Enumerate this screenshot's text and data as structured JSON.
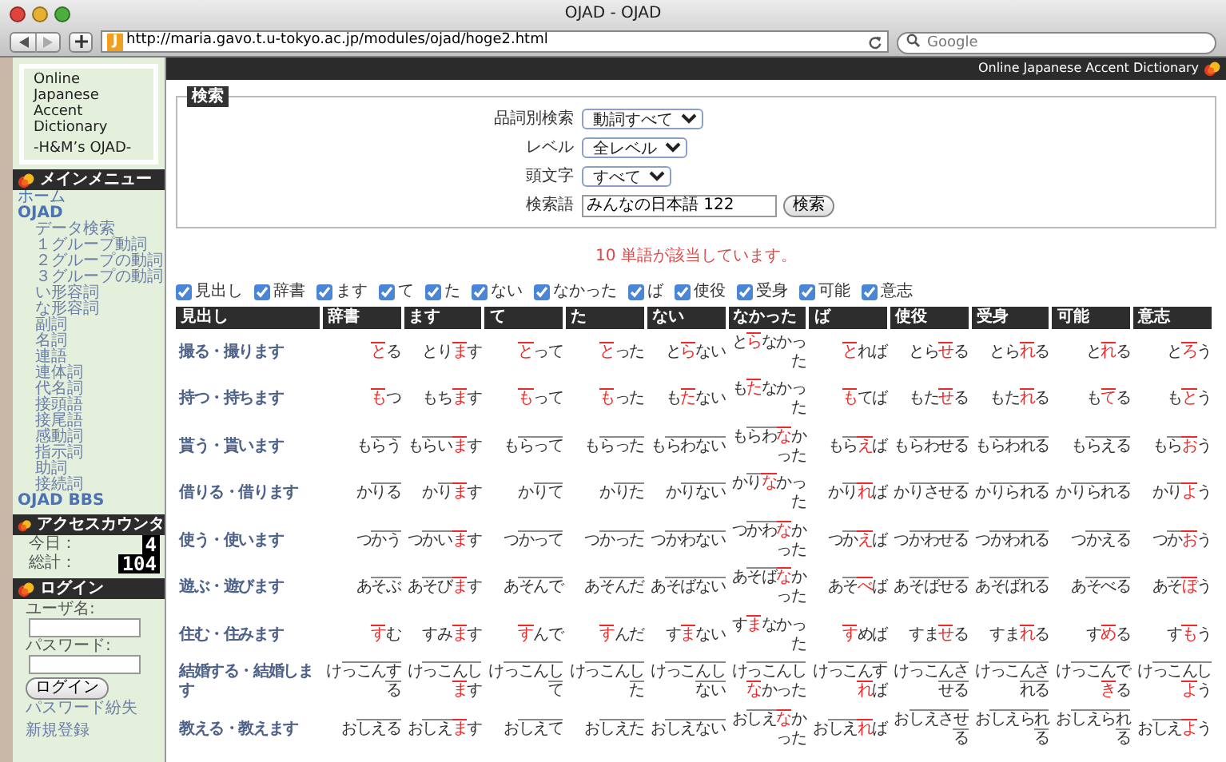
{
  "window": {
    "title": "OJAD - OJAD",
    "favicon": "J",
    "url": "http://maria.gavo.t.u-tokyo.ac.jp/modules/ojad/hoge2.html",
    "search_placeholder": "Google"
  },
  "sidebar": {
    "logo_lines": [
      "Online",
      "Japanese",
      "Accent",
      "Dictionary"
    ],
    "logo_tagline": "-H&M’s OJAD-",
    "menu_title": "メインメニュー",
    "menu": [
      {
        "label": "ホーム",
        "kind": "link"
      },
      {
        "label": "OJAD",
        "kind": "section",
        "children": [
          {
            "label": "データ検索"
          },
          {
            "label": "１グループ動詞"
          },
          {
            "label": "２グループの動詞"
          },
          {
            "label": "３グループの動詞"
          },
          {
            "label": "い形容詞"
          },
          {
            "label": "な形容詞"
          },
          {
            "label": "副詞"
          },
          {
            "label": "名詞"
          },
          {
            "label": "連語"
          },
          {
            "label": "連体詞"
          },
          {
            "label": "代名詞"
          },
          {
            "label": "接頭語"
          },
          {
            "label": "接尾語"
          },
          {
            "label": "感動詞"
          },
          {
            "label": "指示詞"
          },
          {
            "label": "助詞"
          },
          {
            "label": "接続詞"
          }
        ]
      },
      {
        "label": "OJAD BBS",
        "kind": "section"
      }
    ],
    "counter_title": "アクセスカウンタ",
    "counter": [
      {
        "label": "今日：",
        "value": "4"
      },
      {
        "label": "総計：",
        "value": "104"
      }
    ],
    "login_title": "ログイン",
    "login": {
      "username_label": "ユーザ名:",
      "password_label": "パスワード:",
      "button": "ログイン",
      "links": [
        "パスワード紛失",
        "新規登録"
      ]
    }
  },
  "header": "Online Japanese Accent Dictionary",
  "search": {
    "legend": "検索",
    "fields": [
      {
        "label": "品詞別検索",
        "kind": "select",
        "value": "動詞すべて"
      },
      {
        "label": "レベル",
        "kind": "select",
        "value": "全レベル"
      },
      {
        "label": "頭文字",
        "kind": "select",
        "value": "すべて"
      },
      {
        "label": "検索語",
        "kind": "text",
        "value": "みんなの日本語 122"
      }
    ],
    "button": "検索"
  },
  "result": "10 単語が該当しています。",
  "column_toggles": [
    {
      "label": "見出し",
      "checked": true
    },
    {
      "label": "辞書",
      "checked": true
    },
    {
      "label": "ます",
      "checked": true
    },
    {
      "label": "て",
      "checked": true
    },
    {
      "label": "た",
      "checked": true
    },
    {
      "label": "ない",
      "checked": true
    },
    {
      "label": "なかった",
      "checked": true
    },
    {
      "label": "ば",
      "checked": true
    },
    {
      "label": "使役",
      "checked": true
    },
    {
      "label": "受身",
      "checked": true
    },
    {
      "label": "可能",
      "checked": true
    },
    {
      "label": "意志",
      "checked": true
    }
  ],
  "table": {
    "columns": [
      "見出し",
      "辞書",
      "ます",
      "て",
      "た",
      "ない",
      "なかった",
      "ば",
      "使役",
      "受身",
      "可能",
      "意志"
    ],
    "rows": [
      {
        "headword": "撮る・撮ります",
        "forms": [
          [
            {
              "nucleus": "と"
            },
            {
              "low": "る"
            }
          ],
          [
            {
              "low": "とり"
            },
            {
              "nucleus": "ま"
            },
            {
              "low": "す"
            }
          ],
          [
            {
              "nucleus": "と"
            },
            {
              "low": "って"
            }
          ],
          [
            {
              "nucleus": "と"
            },
            {
              "low": "った"
            }
          ],
          [
            {
              "low": "と"
            },
            {
              "nucleus": "ら"
            },
            {
              "low": "ない"
            }
          ],
          [
            {
              "low": "と"
            },
            {
              "nucleus": "ら"
            },
            {
              "low": "なかった"
            }
          ],
          [
            {
              "nucleus": "と"
            },
            {
              "low": "れば"
            }
          ],
          [
            {
              "low": "とら"
            },
            {
              "nucleus": "せ"
            },
            {
              "low": "る"
            }
          ],
          [
            {
              "low": "とら"
            },
            {
              "nucleus": "れ"
            },
            {
              "low": "る"
            }
          ],
          [
            {
              "low": "と"
            },
            {
              "nucleus": "れ"
            },
            {
              "low": "る"
            }
          ],
          [
            {
              "low": "と"
            },
            {
              "nucleus": "ろ"
            },
            {
              "low": "う"
            }
          ]
        ]
      },
      {
        "headword": "持つ・持ちます",
        "forms": [
          [
            {
              "nucleus": "も"
            },
            {
              "low": "つ"
            }
          ],
          [
            {
              "low": "もち"
            },
            {
              "nucleus": "ま"
            },
            {
              "low": "す"
            }
          ],
          [
            {
              "nucleus": "も"
            },
            {
              "low": "って"
            }
          ],
          [
            {
              "nucleus": "も"
            },
            {
              "low": "った"
            }
          ],
          [
            {
              "low": "も"
            },
            {
              "nucleus": "た"
            },
            {
              "low": "ない"
            }
          ],
          [
            {
              "low": "も"
            },
            {
              "nucleus": "た"
            },
            {
              "low": "なかった"
            }
          ],
          [
            {
              "nucleus": "も"
            },
            {
              "low": "てば"
            }
          ],
          [
            {
              "low": "もた"
            },
            {
              "nucleus": "せ"
            },
            {
              "low": "る"
            }
          ],
          [
            {
              "low": "もた"
            },
            {
              "nucleus": "れ"
            },
            {
              "low": "る"
            }
          ],
          [
            {
              "low": "も"
            },
            {
              "nucleus": "て"
            },
            {
              "low": "る"
            }
          ],
          [
            {
              "low": "も"
            },
            {
              "nucleus": "と"
            },
            {
              "low": "う"
            }
          ]
        ]
      },
      {
        "headword": "貰う・貰います",
        "forms": [
          [
            {
              "low": "も"
            },
            {
              "high": "らう"
            }
          ],
          [
            {
              "low": "も"
            },
            {
              "high": "らい"
            },
            {
              "nucleus": "ま"
            },
            {
              "low": "す"
            }
          ],
          [
            {
              "low": "も"
            },
            {
              "high": "らって"
            }
          ],
          [
            {
              "low": "も"
            },
            {
              "high": "らった"
            }
          ],
          [
            {
              "low": "も"
            },
            {
              "high": "らわない"
            }
          ],
          [
            {
              "low": "も"
            },
            {
              "high": "らわ"
            },
            {
              "nucleus": "な"
            },
            {
              "low": "かった"
            }
          ],
          [
            {
              "low": "も"
            },
            {
              "high": "ら"
            },
            {
              "nucleus": "え"
            },
            {
              "low": "ば"
            }
          ],
          [
            {
              "low": "も"
            },
            {
              "high": "らわせる"
            }
          ],
          [
            {
              "low": "も"
            },
            {
              "high": "らわれる"
            }
          ],
          [
            {
              "low": "も"
            },
            {
              "high": "らえる"
            }
          ],
          [
            {
              "low": "も"
            },
            {
              "high": "ら"
            },
            {
              "nucleus": "お"
            },
            {
              "low": "う"
            }
          ]
        ]
      },
      {
        "headword": "借りる・借ります",
        "forms": [
          [
            {
              "low": "か"
            },
            {
              "high": "りる"
            }
          ],
          [
            {
              "low": "か"
            },
            {
              "high": "り"
            },
            {
              "nucleus": "ま"
            },
            {
              "low": "す"
            }
          ],
          [
            {
              "low": "か"
            },
            {
              "high": "りて"
            }
          ],
          [
            {
              "low": "か"
            },
            {
              "high": "りた"
            }
          ],
          [
            {
              "low": "か"
            },
            {
              "high": "りない"
            }
          ],
          [
            {
              "low": "か"
            },
            {
              "high": "り"
            },
            {
              "nucleus": "な"
            },
            {
              "low": "かった"
            }
          ],
          [
            {
              "low": "か"
            },
            {
              "high": "り"
            },
            {
              "nucleus": "れ"
            },
            {
              "low": "ば"
            }
          ],
          [
            {
              "low": "か"
            },
            {
              "high": "りさせる"
            }
          ],
          [
            {
              "low": "か"
            },
            {
              "high": "りられる"
            }
          ],
          [
            {
              "low": "か"
            },
            {
              "high": "りられる"
            }
          ],
          [
            {
              "low": "か"
            },
            {
              "high": "り"
            },
            {
              "nucleus": "よ"
            },
            {
              "low": "う"
            }
          ]
        ]
      },
      {
        "headword": "使う・使います",
        "forms": [
          [
            {
              "low": "つ"
            },
            {
              "high": "かう"
            }
          ],
          [
            {
              "low": "つ"
            },
            {
              "high": "かい"
            },
            {
              "nucleus": "ま"
            },
            {
              "low": "す"
            }
          ],
          [
            {
              "low": "つ"
            },
            {
              "high": "かって"
            }
          ],
          [
            {
              "low": "つ"
            },
            {
              "high": "かった"
            }
          ],
          [
            {
              "low": "つ"
            },
            {
              "high": "かわない"
            }
          ],
          [
            {
              "low": "つ"
            },
            {
              "high": "かわ"
            },
            {
              "nucleus": "な"
            },
            {
              "low": "かった"
            }
          ],
          [
            {
              "low": "つ"
            },
            {
              "high": "か"
            },
            {
              "nucleus": "え"
            },
            {
              "low": "ば"
            }
          ],
          [
            {
              "low": "つ"
            },
            {
              "high": "かわせる"
            }
          ],
          [
            {
              "low": "つ"
            },
            {
              "high": "かわれる"
            }
          ],
          [
            {
              "low": "つ"
            },
            {
              "high": "かえる"
            }
          ],
          [
            {
              "low": "つ"
            },
            {
              "high": "か"
            },
            {
              "nucleus": "お"
            },
            {
              "low": "う"
            }
          ]
        ]
      },
      {
        "headword": "遊ぶ・遊びます",
        "forms": [
          [
            {
              "low": "あ"
            },
            {
              "high": "そぶ"
            }
          ],
          [
            {
              "low": "あ"
            },
            {
              "high": "そび"
            },
            {
              "nucleus": "ま"
            },
            {
              "low": "す"
            }
          ],
          [
            {
              "low": "あ"
            },
            {
              "high": "そんで"
            }
          ],
          [
            {
              "low": "あ"
            },
            {
              "high": "そんだ"
            }
          ],
          [
            {
              "low": "あ"
            },
            {
              "high": "そばない"
            }
          ],
          [
            {
              "low": "あ"
            },
            {
              "high": "そば"
            },
            {
              "nucleus": "な"
            },
            {
              "low": "かった"
            }
          ],
          [
            {
              "low": "あ"
            },
            {
              "high": "そ"
            },
            {
              "nucleus": "べ"
            },
            {
              "low": "ば"
            }
          ],
          [
            {
              "low": "あ"
            },
            {
              "high": "そばせる"
            }
          ],
          [
            {
              "low": "あ"
            },
            {
              "high": "そばれる"
            }
          ],
          [
            {
              "low": "あ"
            },
            {
              "high": "そべる"
            }
          ],
          [
            {
              "low": "あ"
            },
            {
              "high": "そ"
            },
            {
              "nucleus": "ぼ"
            },
            {
              "low": "う"
            }
          ]
        ]
      },
      {
        "headword": "住む・住みます",
        "forms": [
          [
            {
              "nucleus": "す"
            },
            {
              "low": "む"
            }
          ],
          [
            {
              "low": "すみ"
            },
            {
              "nucleus": "ま"
            },
            {
              "low": "す"
            }
          ],
          [
            {
              "nucleus": "す"
            },
            {
              "low": "んで"
            }
          ],
          [
            {
              "nucleus": "す"
            },
            {
              "low": "んだ"
            }
          ],
          [
            {
              "low": "す"
            },
            {
              "nucleus": "ま"
            },
            {
              "low": "ない"
            }
          ],
          [
            {
              "low": "す"
            },
            {
              "nucleus": "ま"
            },
            {
              "low": "なかった"
            }
          ],
          [
            {
              "nucleus": "す"
            },
            {
              "low": "めば"
            }
          ],
          [
            {
              "low": "すま"
            },
            {
              "nucleus": "せ"
            },
            {
              "low": "る"
            }
          ],
          [
            {
              "low": "すま"
            },
            {
              "nucleus": "れ"
            },
            {
              "low": "る"
            }
          ],
          [
            {
              "low": "す"
            },
            {
              "nucleus": "め"
            },
            {
              "low": "る"
            }
          ],
          [
            {
              "low": "す"
            },
            {
              "nucleus": "も"
            },
            {
              "low": "う"
            }
          ]
        ]
      },
      {
        "headword": "結婚する・結婚します",
        "forms": [
          [
            {
              "low": "け"
            },
            {
              "high": "っこんする"
            }
          ],
          [
            {
              "low": "け"
            },
            {
              "high": "っこんし"
            },
            {
              "nucleus": "ま"
            },
            {
              "low": "す"
            }
          ],
          [
            {
              "low": "け"
            },
            {
              "high": "っこんして"
            }
          ],
          [
            {
              "low": "け"
            },
            {
              "high": "っこんした"
            }
          ],
          [
            {
              "low": "け"
            },
            {
              "high": "っこんしない"
            }
          ],
          [
            {
              "low": "け"
            },
            {
              "high": "っこんし"
            },
            {
              "nucleus": "な"
            },
            {
              "low": "かった"
            }
          ],
          [
            {
              "low": "け"
            },
            {
              "high": "っこんす"
            },
            {
              "nucleus": "れ"
            },
            {
              "low": "ば"
            }
          ],
          [
            {
              "low": "け"
            },
            {
              "high": "っこんさせる"
            }
          ],
          [
            {
              "low": "け"
            },
            {
              "high": "っこんされる"
            }
          ],
          [
            {
              "low": "け"
            },
            {
              "high": "っこんで"
            },
            {
              "nucleus": "き"
            },
            {
              "low": "る"
            }
          ],
          [
            {
              "low": "け"
            },
            {
              "high": "っこんし"
            },
            {
              "nucleus": "よ"
            },
            {
              "low": "う"
            }
          ]
        ]
      },
      {
        "headword": "教える・教えます",
        "forms": [
          [
            {
              "low": "お"
            },
            {
              "high": "しえる"
            }
          ],
          [
            {
              "low": "お"
            },
            {
              "high": "しえ"
            },
            {
              "nucleus": "ま"
            },
            {
              "low": "す"
            }
          ],
          [
            {
              "low": "お"
            },
            {
              "high": "しえて"
            }
          ],
          [
            {
              "low": "お"
            },
            {
              "high": "しえた"
            }
          ],
          [
            {
              "low": "お"
            },
            {
              "high": "しえない"
            }
          ],
          [
            {
              "low": "お"
            },
            {
              "high": "しえ"
            },
            {
              "nucleus": "な"
            },
            {
              "low": "かった"
            }
          ],
          [
            {
              "low": "お"
            },
            {
              "high": "しえ"
            },
            {
              "nucleus": "れ"
            },
            {
              "low": "ば"
            }
          ],
          [
            {
              "low": "お"
            },
            {
              "high": "しえさせる"
            }
          ],
          [
            {
              "low": "お"
            },
            {
              "high": "しえられる"
            }
          ],
          [
            {
              "low": "お"
            },
            {
              "high": "しえられる"
            }
          ],
          [
            {
              "low": "お"
            },
            {
              "high": "しえ"
            },
            {
              "nucleus": "よ"
            },
            {
              "low": "う"
            }
          ]
        ]
      }
    ]
  }
}
